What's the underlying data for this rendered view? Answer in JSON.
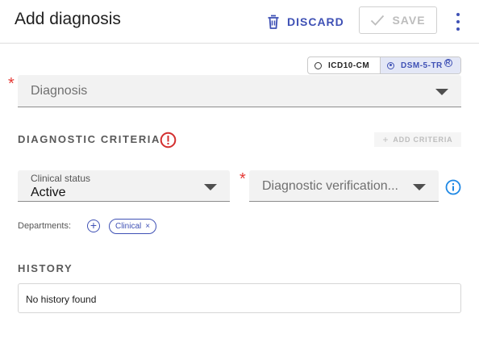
{
  "header": {
    "title": "Add diagnosis",
    "discard_label": "DISCARD",
    "save_label": "SAVE",
    "accent_color": "#3f51b5"
  },
  "code_system": {
    "options": [
      "ICD10-CM",
      "DSM-5-TR"
    ],
    "selected": "DSM-5-TR",
    "trademark": "R"
  },
  "diagnosis_field": {
    "placeholder": "Diagnosis",
    "required_mark": "*"
  },
  "criteria": {
    "heading": "DIAGNOSTIC CRITERIA",
    "add_label": "ADD CRITERIA",
    "plus": "+",
    "alert_icon": "exclamation-circle-icon"
  },
  "clinical_status": {
    "label": "Clinical status",
    "value": "Active"
  },
  "verification": {
    "placeholder": "Diagnostic verification...",
    "required_mark": "*",
    "info_icon": "info-icon"
  },
  "departments": {
    "label": "Departments:",
    "add": "+",
    "chips": [
      "Clinical"
    ],
    "remove": "×"
  },
  "history": {
    "heading": "HISTORY",
    "empty_text": "No history found"
  }
}
